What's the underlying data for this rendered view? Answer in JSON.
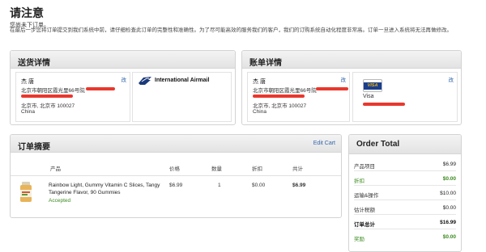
{
  "notice": {
    "title": "请注意",
    "subtitle": "您尚未下订单。",
    "body": "在最后一步您将订单提交到我们系统中前，请仔细检查此订单的完整性和准确性。为了尽可能高效的服务我们的客户，我们的订购系统自动化程度非常高。订单一旦进入系统将无法再做修改。"
  },
  "shipping": {
    "title": "送货详情",
    "name": "杰 唐",
    "edit_label": "改",
    "address_line": "北京市朝阳区霞光里66号院",
    "city_line": "北京市, 北京市 100027",
    "country": "China",
    "method": "International Airmail",
    "method_icon": "usps-eagle-icon"
  },
  "billing": {
    "title": "账单详情",
    "name": "杰 唐",
    "edit_label": "改",
    "address_line": "北京市朝阳区霞光里66号院",
    "city_line": "北京市, 北京市 100027",
    "country": "China",
    "card_brand": "VISA",
    "card_label": "Visa",
    "card_edit_label": "改",
    "card_icon": "visa-card-icon"
  },
  "summary": {
    "title": "订单摘要",
    "edit_cart": "Edit Cart",
    "headers": {
      "product": "产品",
      "price": "价格",
      "qty": "数量",
      "discount": "折扣",
      "total": "共计"
    },
    "items": [
      {
        "name": "Rainbow Light, Gummy Vitamin C Slices, Tangy Tangerine Flavor, 90 Gummies",
        "status": "Accepted",
        "price": "$6.99",
        "qty": "1",
        "discount": "$0.00",
        "total": "$6.99",
        "icon": "vitamin-bottle-icon"
      }
    ]
  },
  "order_total": {
    "title": "Order Total",
    "rows": [
      {
        "label": "产品项目",
        "value": "$6.99"
      },
      {
        "label": "折扣",
        "value": "$0.00"
      },
      {
        "label": "运输&操作",
        "value": "$10.00"
      },
      {
        "label": "估计税额",
        "value": "$0.00"
      },
      {
        "label": "订单总计",
        "value": "$16.99"
      },
      {
        "label": "奖励",
        "value": "$0.00"
      }
    ]
  },
  "colors": {
    "redaction": "#e8382e",
    "accepted": "#3b8a1f",
    "link": "#3366aa"
  }
}
